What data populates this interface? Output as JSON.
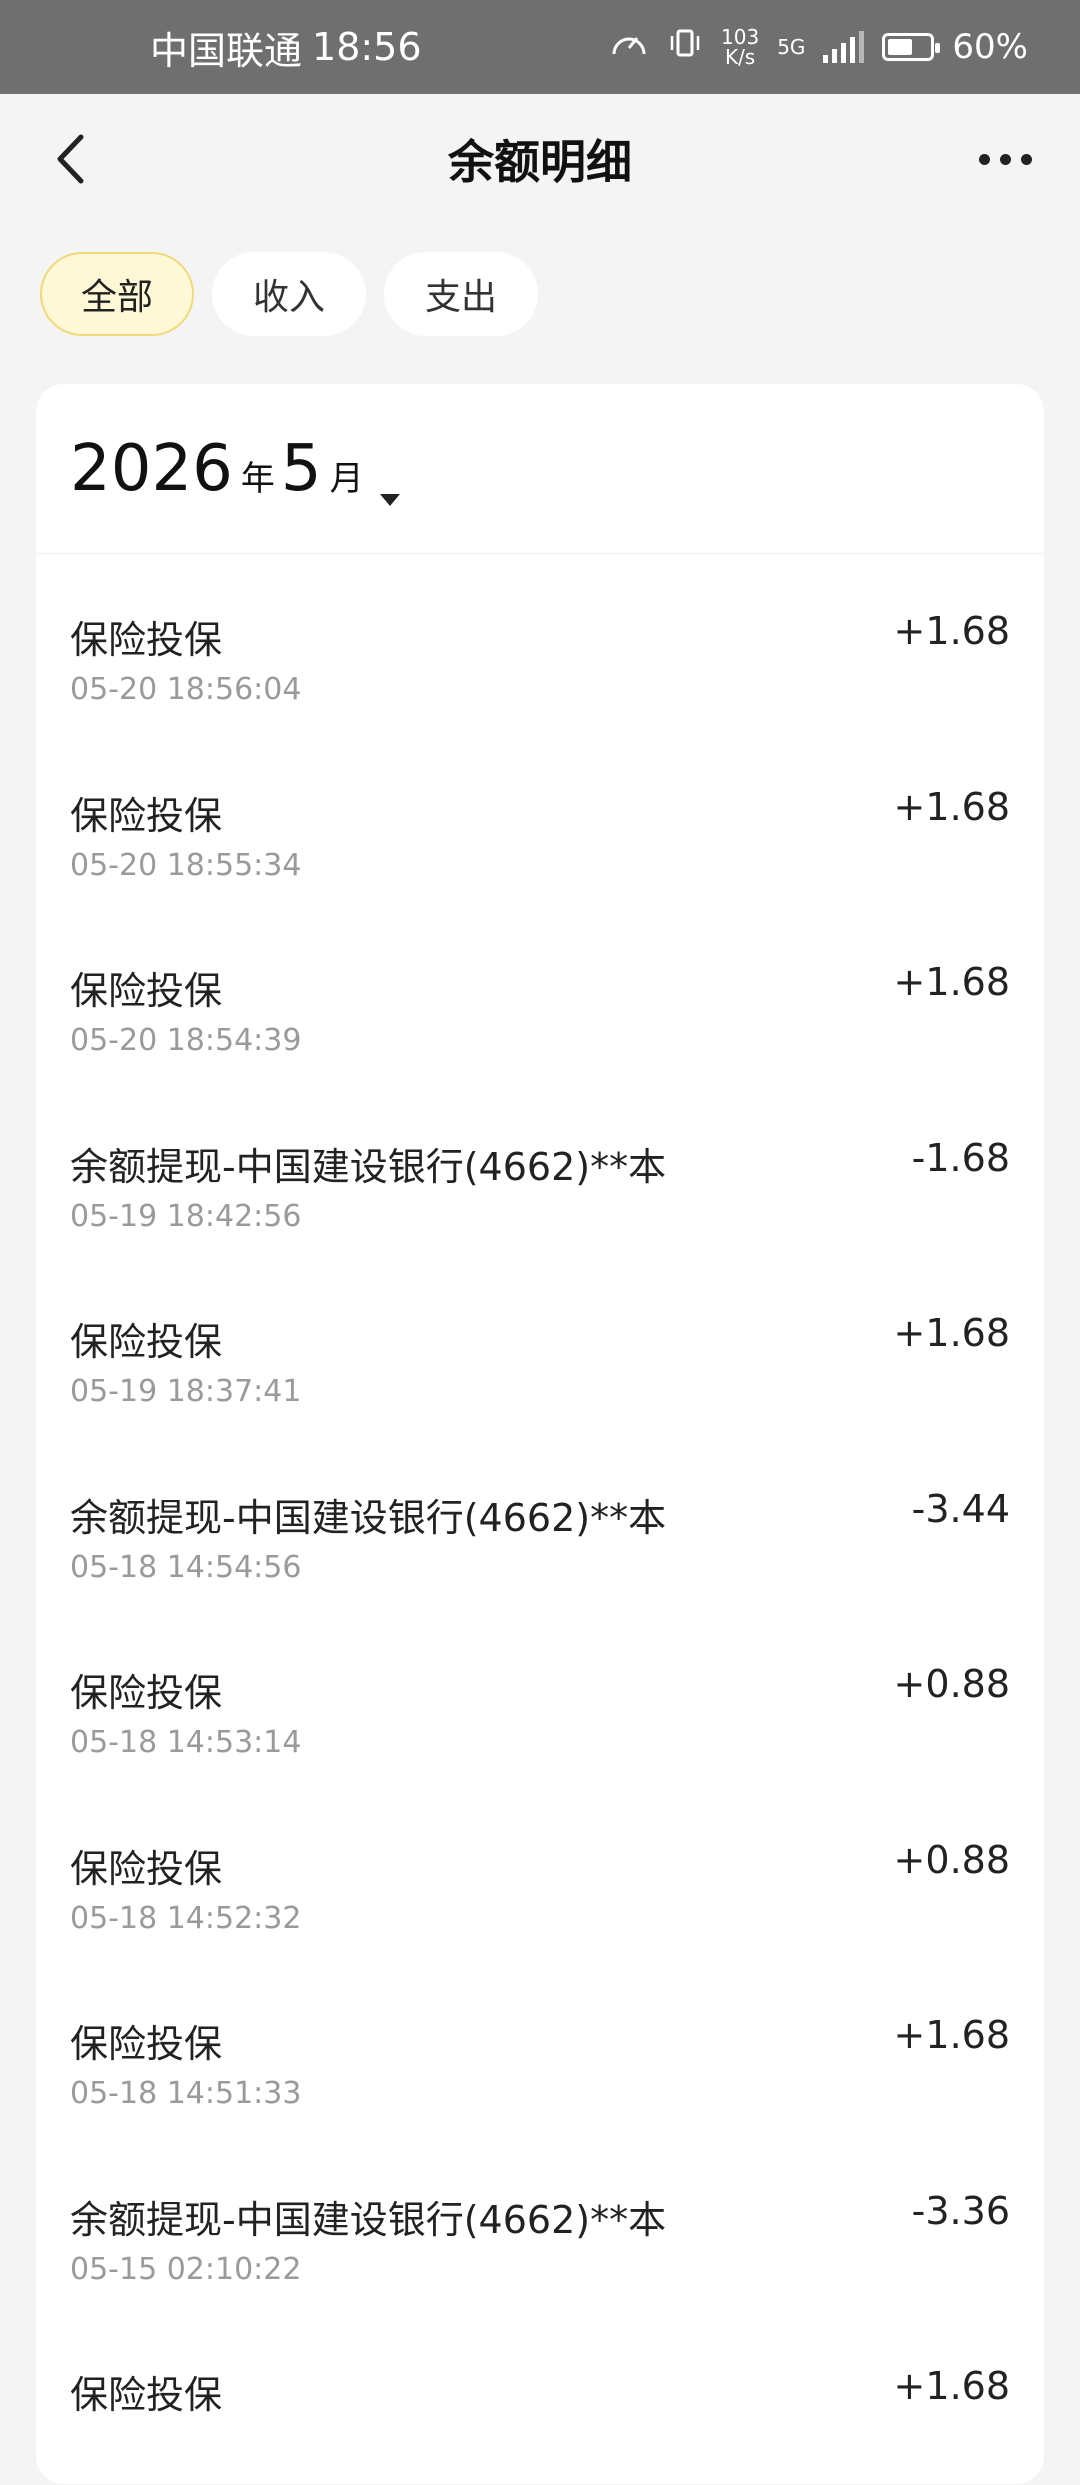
{
  "status_bar": {
    "carrier": "中国联通",
    "time": "18:56",
    "speed_value": "103",
    "speed_unit": "K/s",
    "network": "5G",
    "battery": "60%",
    "battery_level": 0.6
  },
  "header": {
    "title": "余额明细"
  },
  "tabs": [
    {
      "label": "全部",
      "active": true
    },
    {
      "label": "收入",
      "active": false
    },
    {
      "label": "支出",
      "active": false
    }
  ],
  "month_selector": {
    "year": "2026",
    "year_suffix": "年",
    "month": "5",
    "month_suffix": "月"
  },
  "transactions": [
    {
      "name": "保险投保",
      "time": "05-20 18:56:04",
      "amount": "+1.68"
    },
    {
      "name": "保险投保",
      "time": "05-20 18:55:34",
      "amount": "+1.68"
    },
    {
      "name": "保险投保",
      "time": "05-20 18:54:39",
      "amount": "+1.68"
    },
    {
      "name": "余额提现-中国建设银行(4662)**本",
      "time": "05-19 18:42:56",
      "amount": "-1.68"
    },
    {
      "name": "保险投保",
      "time": "05-19 18:37:41",
      "amount": "+1.68"
    },
    {
      "name": "余额提现-中国建设银行(4662)**本",
      "time": "05-18 14:54:56",
      "amount": "-3.44"
    },
    {
      "name": "保险投保",
      "time": "05-18 14:53:14",
      "amount": "+0.88"
    },
    {
      "name": "保险投保",
      "time": "05-18 14:52:32",
      "amount": "+0.88"
    },
    {
      "name": "保险投保",
      "time": "05-18 14:51:33",
      "amount": "+1.68"
    },
    {
      "name": "余额提现-中国建设银行(4662)**本",
      "time": "05-15 02:10:22",
      "amount": "-3.36"
    },
    {
      "name": "保险投保",
      "time": "",
      "amount": "+1.68"
    }
  ]
}
